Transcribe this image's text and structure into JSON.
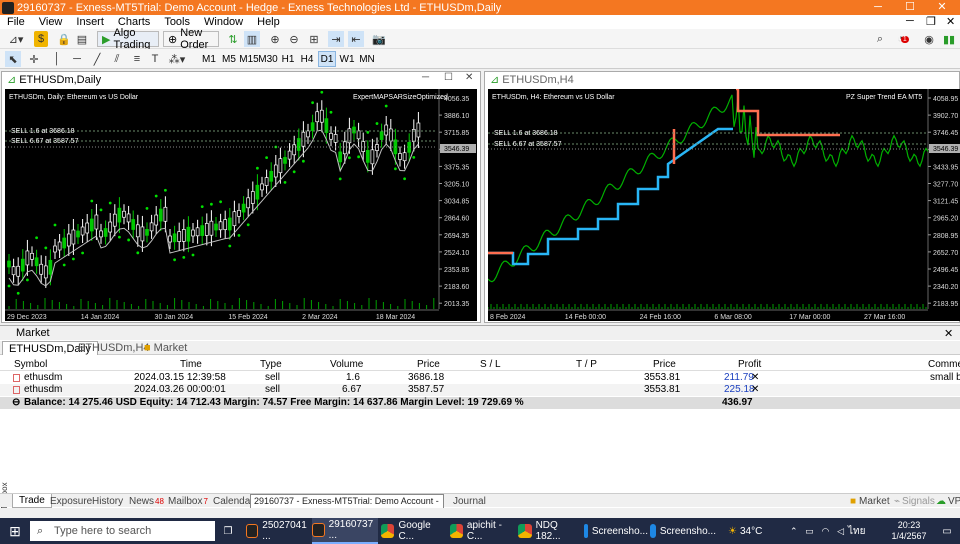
{
  "window": {
    "title": "29160737 - Exness-MT5Trial: Demo Account - Hedge - Exness Technologies Ltd - ETHUSDm,Daily",
    "notif_count": "1"
  },
  "menu": [
    "File",
    "View",
    "Insert",
    "Charts",
    "Tools",
    "Window",
    "Help"
  ],
  "toolbar": {
    "algo_trading": "Algo Trading",
    "new_order": "New Order",
    "timeframes": [
      "M1",
      "M5",
      "M15",
      "M30",
      "H1",
      "H4",
      "D1",
      "W1",
      "MN"
    ],
    "active_tf": "D1"
  },
  "chart1": {
    "title": "ETHUSDm,Daily",
    "symbol_info": "ETHUSDm, Daily:  Ethereum vs US Dollar",
    "ea": "ExpertMAPSARSizeOptimized",
    "sell1": "SELL 1.6 at 3686.18",
    "sell2": "SELL 6.67 at 3587.57",
    "price_labels": [
      "4056.35",
      "3886.10",
      "3715.85",
      "3546.39",
      "3375.35",
      "3205.10",
      "3034.85",
      "2864.60",
      "2694.35",
      "2524.10",
      "2353.85",
      "2183.60",
      "2013.35"
    ],
    "current_price": "3546.39",
    "date_labels": [
      "29 Dec 2023",
      "14 Jan 2024",
      "30 Jan 2024",
      "15 Feb 2024",
      "2 Mar 2024",
      "18 Mar 2024"
    ],
    "colors": {
      "up": "#ffffff",
      "down": "#00c800",
      "sar": "#00e000",
      "ma": "#c0c0c0"
    }
  },
  "chart2": {
    "title": "ETHUSDm,H4",
    "symbol_info": "ETHUSDm, H4:  Ethereum vs US Dollar",
    "ea": "PZ Super Trend EA MT5",
    "sell1": "SELL 1.6 at 3686.18",
    "sell2": "SELL 6.67 at 3587.57",
    "price_labels": [
      "4058.95",
      "3902.70",
      "3746.45",
      "3590.20",
      "3433.95",
      "3277.70",
      "3121.45",
      "2965.20",
      "2808.95",
      "2652.70",
      "2496.45",
      "2340.20",
      "2183.95"
    ],
    "current_price": "3546.39",
    "date_labels": [
      "8 Feb 2024",
      "14 Feb 00:00",
      "24 Feb 16:00",
      "6 Mar 08:00",
      "17 Mar 00:00",
      "27 Mar 16:00"
    ],
    "colors": {
      "up": "#00b000",
      "trend_up": "#29b6f6",
      "trend_down": "#ff6e50"
    }
  },
  "trade_panel": {
    "header": "Market",
    "chart_tabs": [
      "ETHUSDm,Daily",
      "ETHUSDm,H4",
      "Market"
    ],
    "columns": [
      "Symbol",
      "Time",
      "Type",
      "Volume",
      "Price",
      "S / L",
      "T / P",
      "Price",
      "Profit",
      "Comment"
    ],
    "rows": [
      {
        "symbol": "ethusdm",
        "time": "2024.03.15 12:39:58",
        "type": "sell",
        "volume": "1.6",
        "price": "3686.18",
        "sl": "",
        "tp": "",
        "cur": "3553.81",
        "profit": "211.79",
        "comment": "small bo"
      },
      {
        "symbol": "ethusdm",
        "time": "2024.03.26 00:00:01",
        "type": "sell",
        "volume": "6.67",
        "price": "3587.57",
        "sl": "",
        "tp": "",
        "cur": "3553.81",
        "profit": "225.18",
        "comment": ""
      }
    ],
    "summary": "Balance: 14 275.46 USD  Equity: 14 712.43  Margin: 74.57  Free Margin: 14 637.86  Margin Level: 19 729.69 %",
    "total_profit": "436.97"
  },
  "bottom_tabs": [
    {
      "label": "Trade",
      "badge": ""
    },
    {
      "label": "Exposure",
      "badge": ""
    },
    {
      "label": "History",
      "badge": ""
    },
    {
      "label": "News",
      "badge": "48"
    },
    {
      "label": "Mailbox",
      "badge": "7"
    },
    {
      "label": "Calendar",
      "badge": ""
    },
    {
      "label": "Journal",
      "badge": ""
    }
  ],
  "bottom_right": {
    "market": "Market",
    "signals": "Signals",
    "vps": "VPS"
  },
  "toolbox_label": "Toolbox",
  "tooltip": "29160737 - Exness-MT5Trial: Demo Account - Hedge - Exness Technologies Ltd - ETHUSDm,Daily",
  "taskbar": {
    "search_placeholder": "Type here to search",
    "items": [
      "25027041 ...",
      "29160737 ...",
      "Google C...",
      "apichit - C...",
      "NDQ 182...",
      "Screensho...",
      "Screensho..."
    ],
    "temp": "34°C",
    "lang": "ไทย",
    "time": "20:23",
    "date": "1/4/2567"
  }
}
